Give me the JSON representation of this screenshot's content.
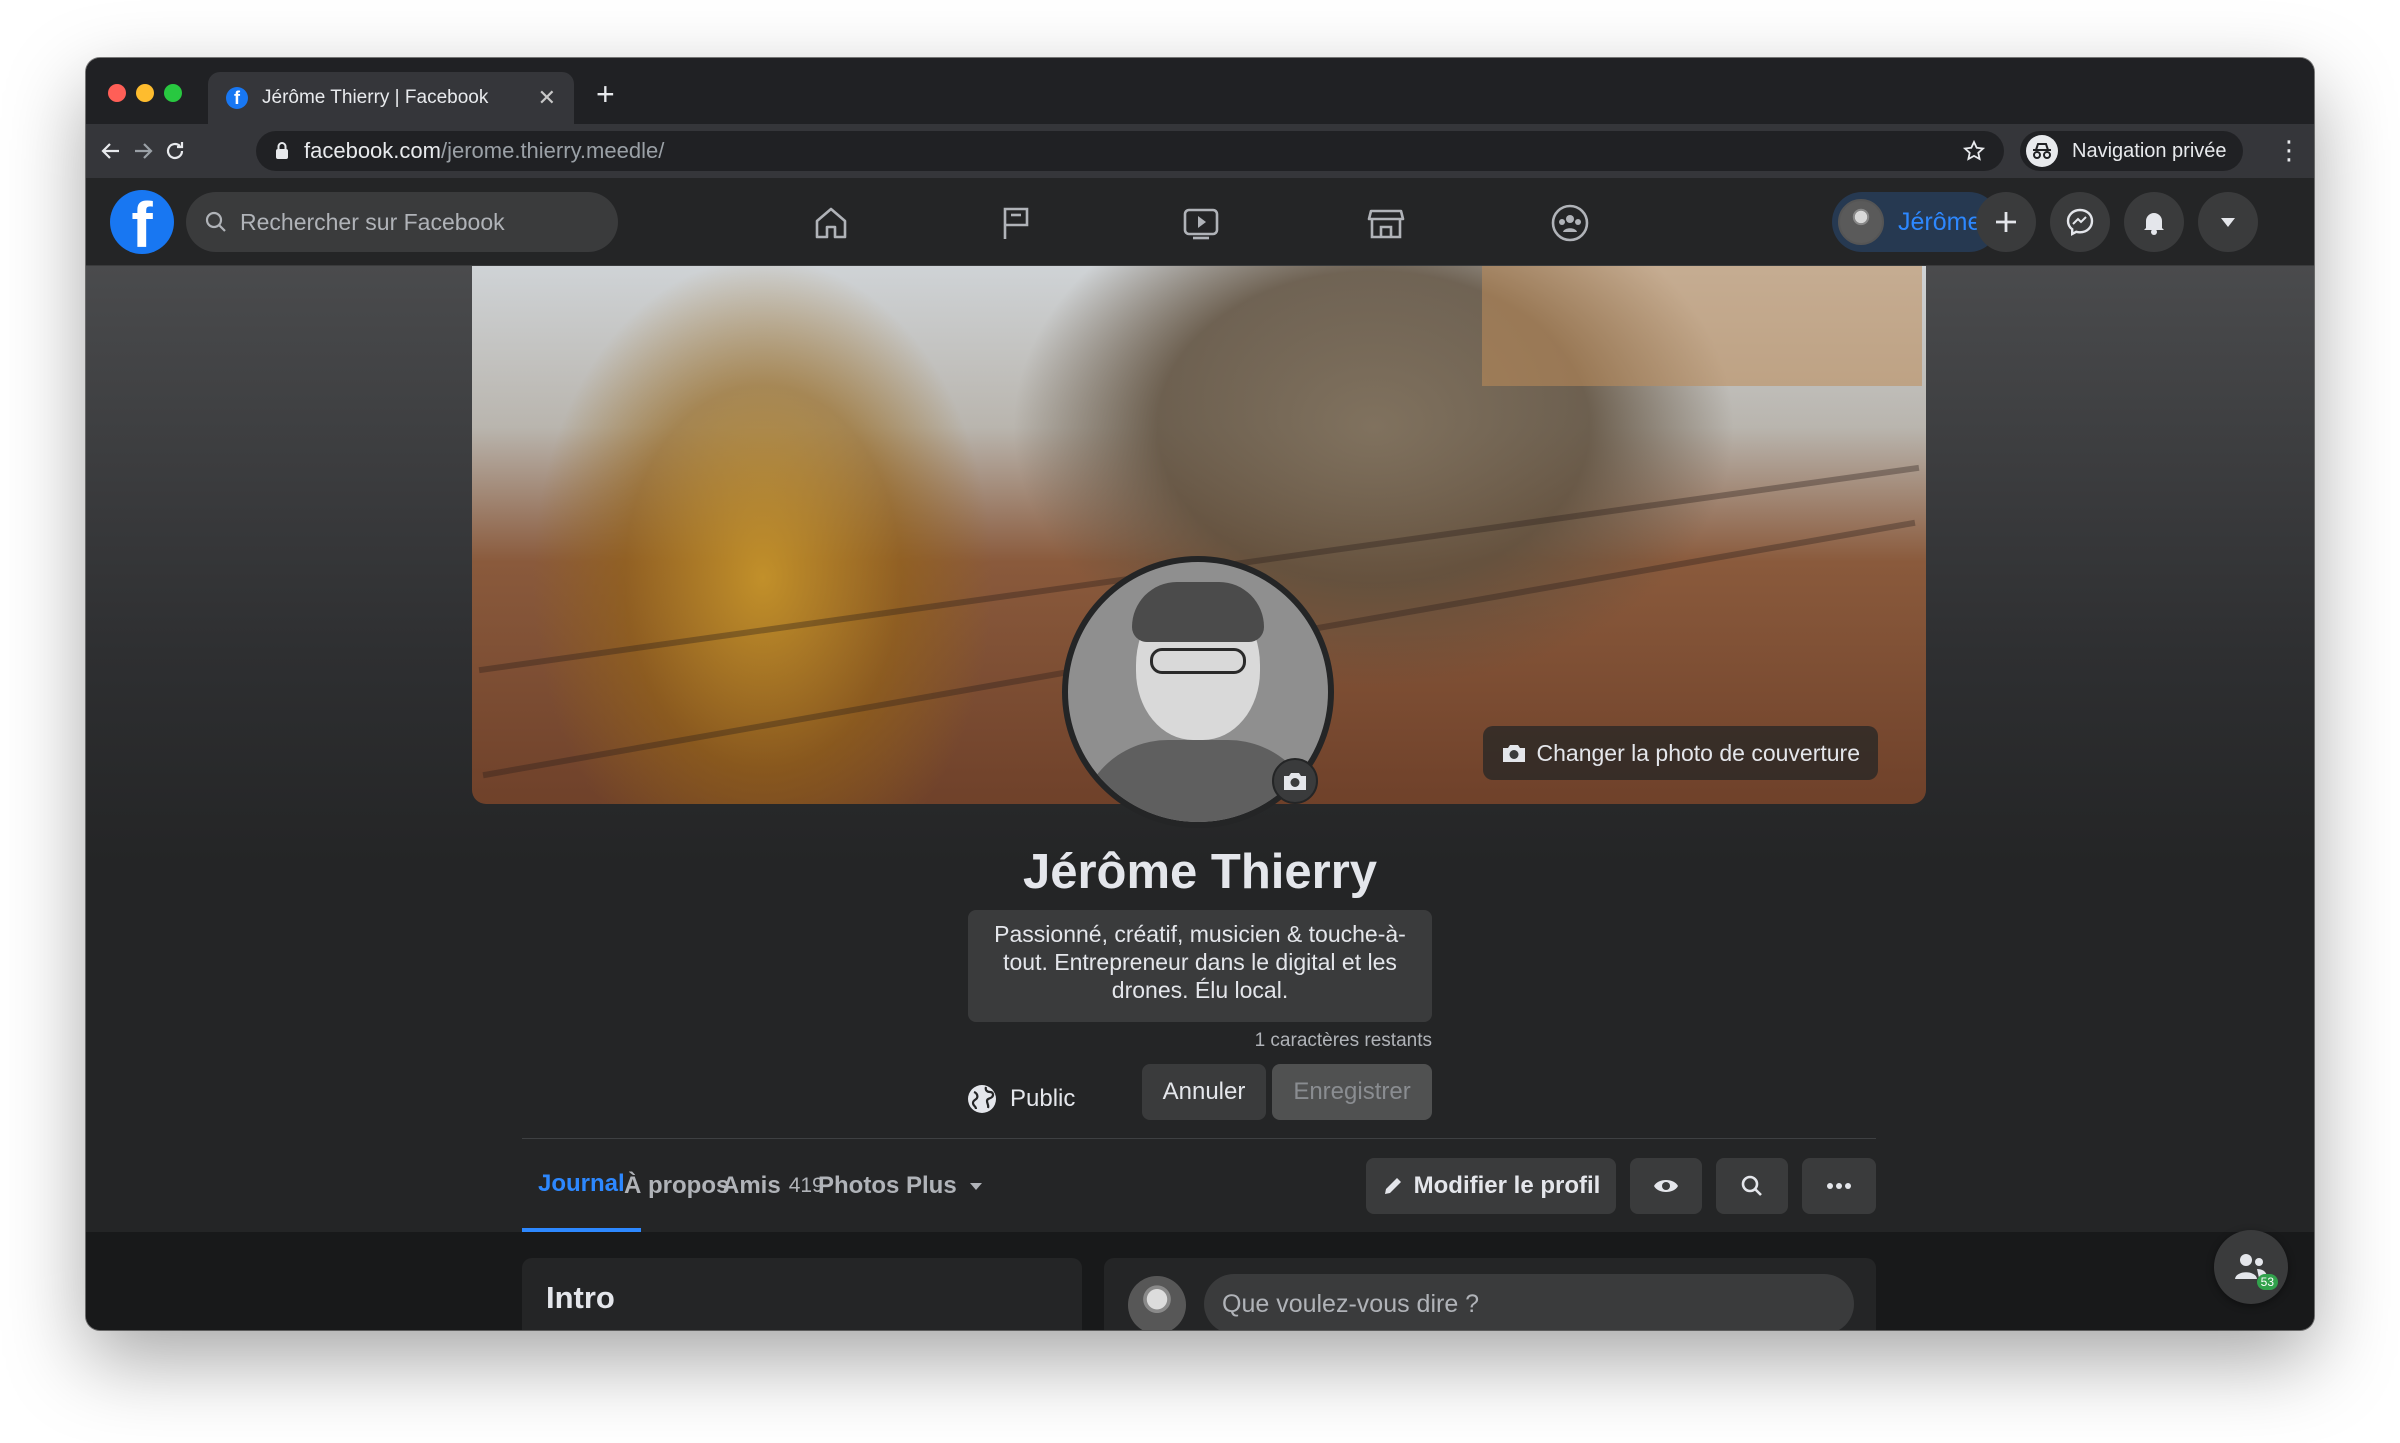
{
  "browser": {
    "tab_title": "Jérôme Thierry | Facebook",
    "url_host": "facebook.com",
    "url_path": "/jerome.thierry.meedle/",
    "incognito_label": "Navigation privée"
  },
  "fb_header": {
    "search_placeholder": "Rechercher sur Facebook",
    "nav_icons": [
      "home-icon",
      "pages-flag-icon",
      "watch-video-icon",
      "marketplace-icon",
      "groups-icon"
    ],
    "profile_chip_name": "Jérôme",
    "action_icons": [
      "plus-icon",
      "messenger-icon",
      "notifications-bell-icon",
      "account-menu-chevron-icon"
    ],
    "accent_color": "#2d88ff"
  },
  "profile": {
    "cover_button_label": "Changer la photo de couverture",
    "name": "Jérôme Thierry",
    "bio_text": "Passionné, créatif, musicien & touche-à-tout. Entrepreneur dans le digital et les drones. Élu local.",
    "chars_left": "1 caractères restants",
    "privacy_label": "Public",
    "cancel_label": "Annuler",
    "save_label": "Enregistrer"
  },
  "profile_tabs": [
    {
      "label": "Journal",
      "active": true
    },
    {
      "label": "À propos"
    },
    {
      "label": "Amis",
      "count": "419"
    },
    {
      "label": "Photos"
    },
    {
      "label": "Plus"
    }
  ],
  "profile_actions": {
    "edit_profile_label": "Modifier le profil",
    "icons": [
      "view-as-eye-icon",
      "search-icon",
      "more-options-icon"
    ]
  },
  "content": {
    "intro_title": "Intro",
    "post_placeholder": "Que voulez-vous dire ?"
  },
  "contacts_fab": {
    "badge": "53"
  }
}
